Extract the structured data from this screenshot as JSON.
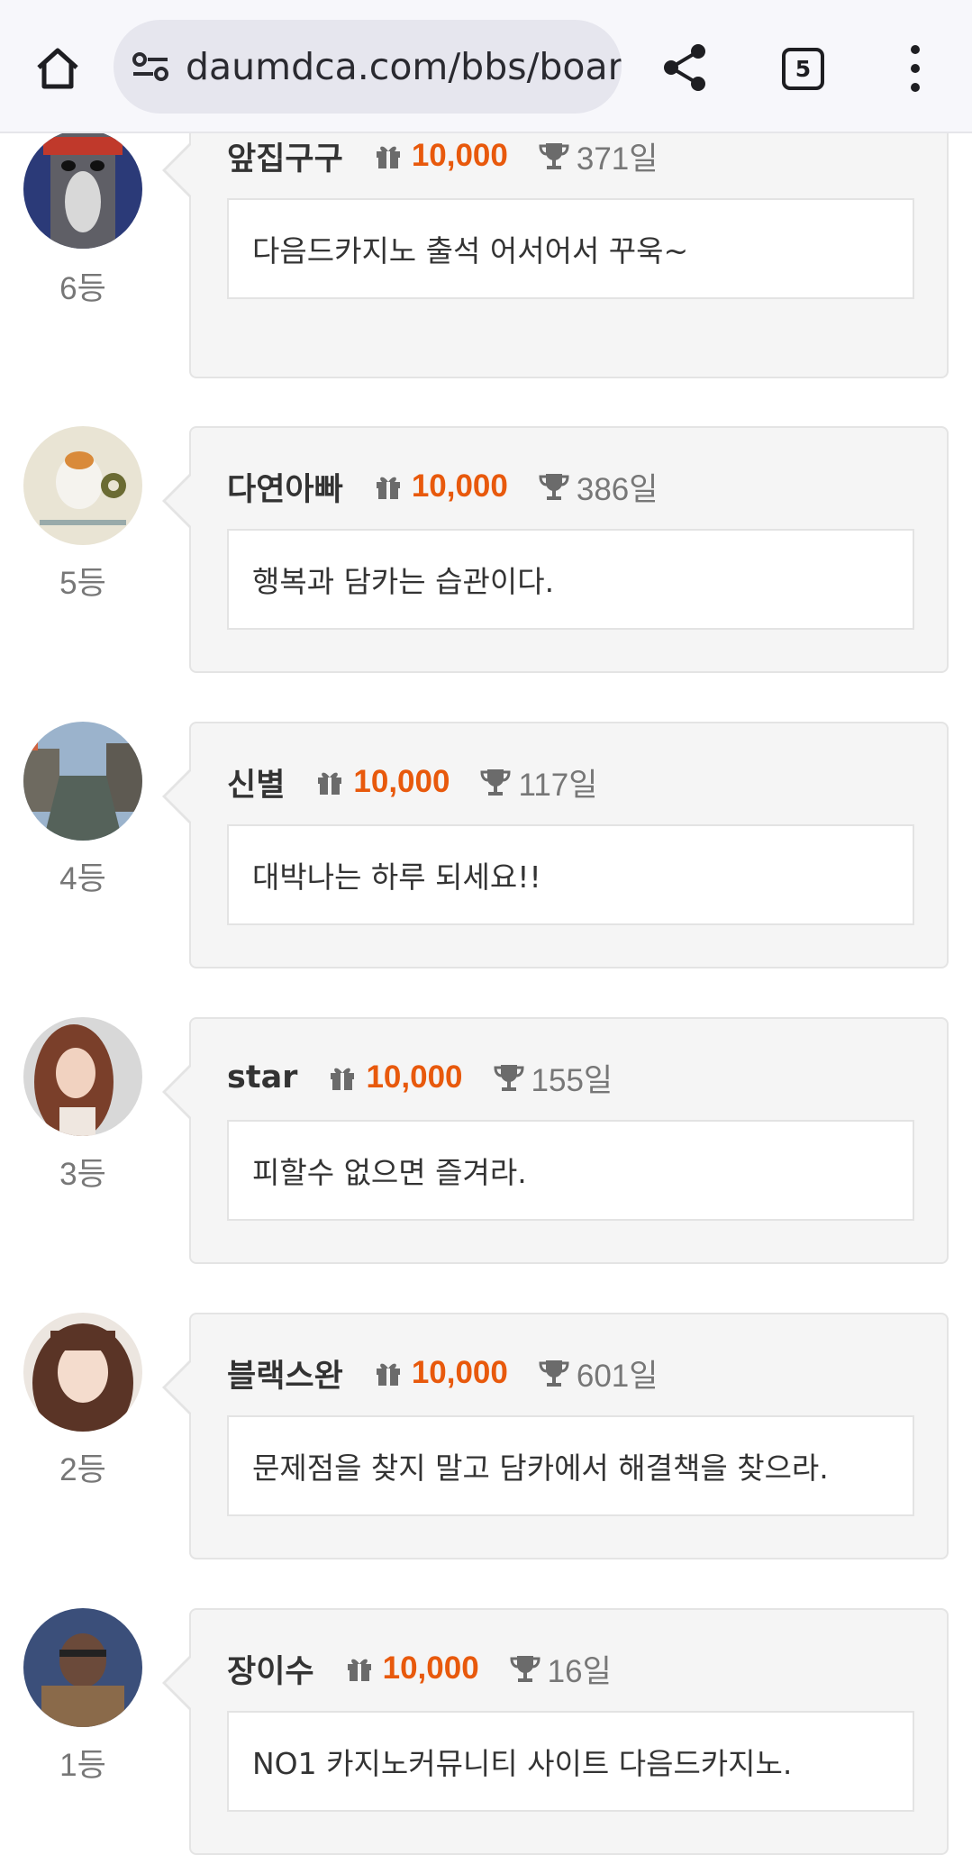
{
  "browser": {
    "url": "daumdca.com/bbs/boar",
    "tab_count": "5"
  },
  "entries": [
    {
      "nick": "앞집구구",
      "points": "10,000",
      "days": "371일",
      "message": "다음드카지노 출석 어서어서 꾸욱~",
      "rank": "6등"
    },
    {
      "nick": "다연아빠",
      "points": "10,000",
      "days": "386일",
      "message": "행복과 담카는 습관이다.",
      "rank": "5등"
    },
    {
      "nick": "신별",
      "points": "10,000",
      "days": "117일",
      "message": "대박나는 하루 되세요!!",
      "rank": "4등"
    },
    {
      "nick": "star",
      "points": "10,000",
      "days": "155일",
      "message": "피할수 없으면 즐겨라.",
      "rank": "3등"
    },
    {
      "nick": "블랙스완",
      "points": "10,000",
      "days": "601일",
      "message": "문제점을 찾지 말고 담카에서 해결책을 찾으라.",
      "rank": "2등"
    },
    {
      "nick": "장이수",
      "points": "10,000",
      "days": "16일",
      "message": "NO1 카지노커뮤니티 사이트 다음드카지노.",
      "rank": "1등"
    }
  ],
  "colors": {
    "points": "#e8590c",
    "card_bg": "#f5f5f5",
    "toolbar_bg": "#f7f7fb"
  },
  "icons": {
    "home": "home-icon",
    "site_settings": "site-settings-icon",
    "share": "share-icon",
    "menu": "more-vert-icon",
    "gift": "gift-icon",
    "trophy": "trophy-icon"
  }
}
